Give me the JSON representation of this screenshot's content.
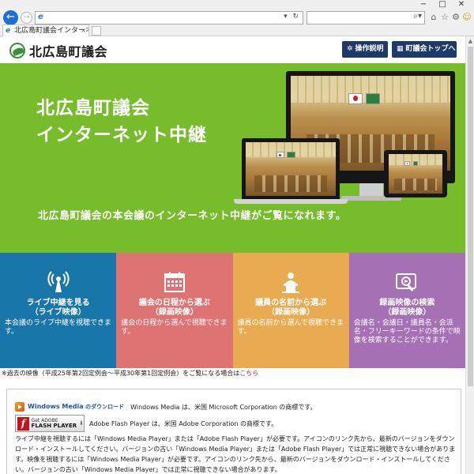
{
  "browser": {
    "tab_title": "北広島町議会インターネット中継",
    "address_text": "",
    "search_text": "",
    "tab_close": "×"
  },
  "header": {
    "logo_text": "北広島町議会",
    "help_button": "操作説明",
    "top_button": "町議会トップへ"
  },
  "hero": {
    "title_line1": "北広島町議会",
    "title_line2": "インターネット中継",
    "subtitle": "北広島町議会の本会議のインターネット中継がご覧になれます。"
  },
  "tiles": [
    {
      "title_line1": "ライブ中継を見る",
      "title_line2": "（ライブ映像）",
      "desc": "本会議のライブ中継を視聴できます。",
      "icon": "broadcast-icon",
      "color": "#1976a8"
    },
    {
      "title_line1": "議会の日程から選ぶ",
      "title_line2": "（録画映像）",
      "desc": "議会の日程から選んで視聴できます。",
      "icon": "calendar-icon",
      "color": "#de7373"
    },
    {
      "title_line1": "議員の名前から選ぶ",
      "title_line2": "（録画映像）",
      "desc": "議員の名前から選んで視聴できます。",
      "icon": "speaker-podium-icon",
      "color": "#e9ab52"
    },
    {
      "title_line1": "録画映像の検索",
      "title_line2": "（録画映像）",
      "desc": "会議名・会議日・議員名・会派名・フリーキーワードの条件で映像を検索することができます。",
      "icon": "video-search-icon",
      "color": "#a570b4"
    }
  ],
  "notice": {
    "text": "※過去の映像（平成25年第2回定例会〜平成30年第1回定例会）をご覧になる場合は",
    "link": "こちら"
  },
  "plugins": {
    "wm_link_main": "Windows Media",
    "wm_link_suffix": " のダウンロード",
    "wm_trademark": "Windows Media は、米国 Microsoft Corporation の商標です。",
    "flash_badge_line1": "Get ADOBE",
    "flash_badge_line2": "FLASH PLAYER",
    "flash_trademark": "Adobe Flash Player は、米国 Adobe Corporation の商標です。",
    "body_text": "ライブ中継を視聴するには「Windows Media Player」または「Adobe Flash Player」が必要です。アイコンのリンク先から、最新のバージョンをダウンロード・インストールしてください。バージョンの古い「Windows Media Player」または「Adobe Flash Player」では正常に視聴できない場合があります。映像を視聴するには「Windows Media Player」が必要です。アイコンのリンク先から、最新のバージョンをダウンロード・インストールしてください。バージョンの古い「Windows Media Player」では正常に視聴できない場合があります。"
  }
}
